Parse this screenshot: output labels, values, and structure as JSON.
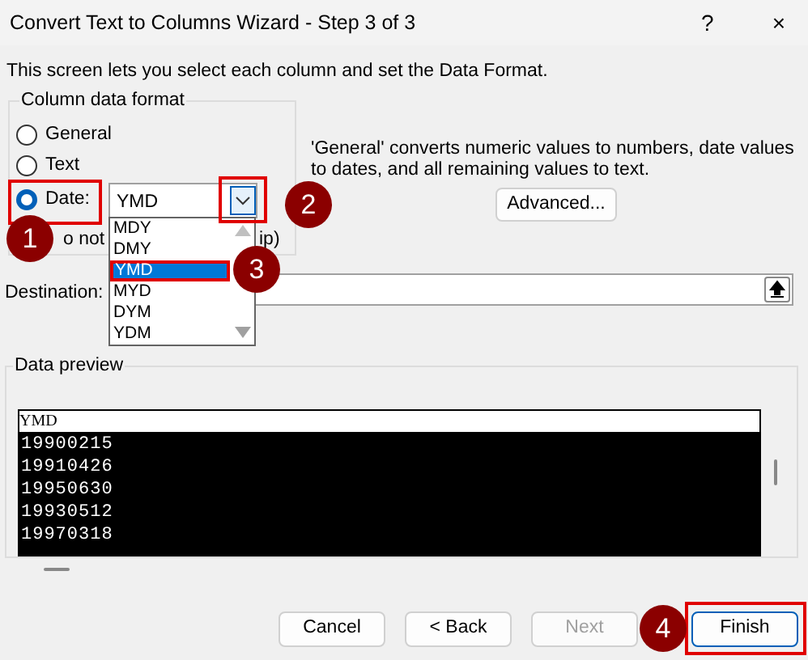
{
  "window": {
    "title": "Convert Text to Columns Wizard - Step 3 of 3",
    "help": "?",
    "close": "×"
  },
  "instruction": "This screen lets you select each column and set the Data Format.",
  "column_data_format": {
    "title": "Column data format",
    "options": [
      {
        "label": "General",
        "selected": false
      },
      {
        "label": "Text",
        "selected": false
      },
      {
        "label": "Date:",
        "selected": true
      }
    ],
    "date_format": "YMD",
    "skip_label_start": "o not",
    "skip_label_end": "ip)"
  },
  "date_dropdown": {
    "items": [
      {
        "label": "MDY",
        "selected": false
      },
      {
        "label": "DMY",
        "selected": false
      },
      {
        "label": "YMD",
        "selected": true
      },
      {
        "label": "MYD",
        "selected": false
      },
      {
        "label": "DYM",
        "selected": false
      },
      {
        "label": "YDM",
        "selected": false
      }
    ]
  },
  "explanation": "'General' converts numeric values to numbers, date values to dates, and all remaining values to text.",
  "advanced_button": "Advanced...",
  "destination": {
    "label": "Destination:"
  },
  "data_preview": {
    "title": "Data preview",
    "header": "YMD",
    "rows": [
      "19900215",
      "19910426",
      "19950630",
      "19930512",
      "19970318"
    ]
  },
  "buttons": [
    {
      "label": "Cancel",
      "disabled": false,
      "default": false
    },
    {
      "label": "< Back",
      "disabled": false,
      "default": false
    },
    {
      "label": "Next",
      "disabled": true,
      "default": false
    },
    {
      "label": "Finish",
      "disabled": false,
      "default": true
    }
  ],
  "callouts": [
    "1",
    "2",
    "3",
    "4"
  ]
}
